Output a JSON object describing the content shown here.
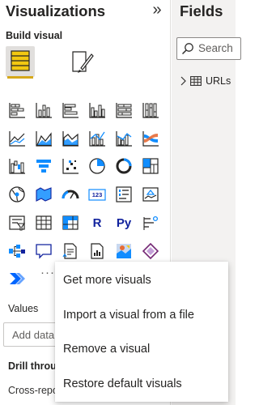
{
  "visualizations": {
    "title": "Visualizations",
    "collapse_glyph": "»",
    "build_visual_label": "Build visual",
    "build_visual_icon": "build-visual-icon",
    "format_visual_icon": "format-visual-paintbrush-icon",
    "accent_color": "#d6a81a",
    "more_glyph": "···",
    "visual_types": [
      "stacked-bar-chart-icon",
      "stacked-column-chart-icon",
      "clustered-bar-chart-icon",
      "clustered-column-chart-icon",
      "100-stacked-bar-chart-icon",
      "100-stacked-column-chart-icon",
      "line-chart-icon",
      "area-chart-icon",
      "stacked-area-chart-icon",
      "line-and-stacked-column-chart-icon",
      "line-and-clustered-column-chart-icon",
      "ribbon-chart-icon",
      "waterfall-chart-icon",
      "funnel-chart-icon",
      "scatter-chart-icon",
      "pie-chart-icon",
      "donut-chart-icon",
      "treemap-icon",
      "map-icon",
      "filled-map-icon",
      "gauge-icon",
      "card-icon",
      "multi-row-card-icon",
      "kpi-icon",
      "slicer-icon",
      "table-icon",
      "matrix-icon",
      "r-script-visual-icon",
      "python-visual-icon",
      "key-influencers-icon",
      "decomposition-tree-icon",
      "qa-icon",
      "smart-narrative-icon",
      "paginated-report-icon",
      "arcgis-map-icon",
      "power-apps-icon",
      "power-automate-icon"
    ],
    "glyph_r": "R",
    "glyph_py": "Py",
    "glyph_123": "123",
    "values_label": "Values",
    "add_data_placeholder": "Add data fields here",
    "drill_through_label": "Drill through",
    "cross_report_label": "Cross-report"
  },
  "fields": {
    "title": "Fields",
    "search_placeholder": "Search",
    "tree": [
      {
        "label": "URLs",
        "icon": "table-icon",
        "expanded": false
      }
    ]
  },
  "context_menu": {
    "items": [
      "Get more visuals",
      "Import a visual from a file",
      "Remove a visual",
      "Restore default visuals"
    ]
  }
}
